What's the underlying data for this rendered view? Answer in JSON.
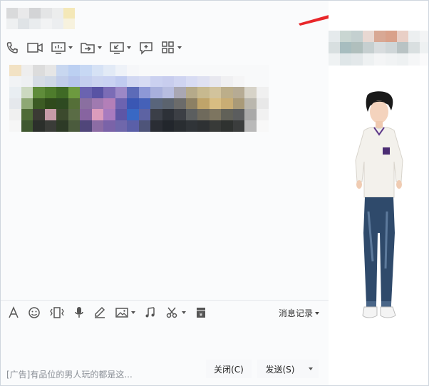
{
  "window": {
    "minimize_icon": "minimize-icon",
    "maximize_icon": "maximize-icon",
    "close_icon": "close-icon",
    "menu_icon": "dropdown-triangle-icon"
  },
  "toolbar": {
    "items": [
      {
        "icon": "phone-icon",
        "has_dropdown": false
      },
      {
        "icon": "video-camera-icon",
        "has_dropdown": false
      },
      {
        "icon": "screen-share-icon",
        "has_dropdown": true
      },
      {
        "icon": "send-file-icon",
        "has_dropdown": true
      },
      {
        "icon": "remote-desktop-icon",
        "has_dropdown": true
      },
      {
        "icon": "add-chat-icon",
        "has_dropdown": false
      },
      {
        "icon": "apps-grid-icon",
        "has_dropdown": true
      }
    ]
  },
  "input_toolbar": {
    "items": [
      {
        "icon": "font-icon"
      },
      {
        "icon": "emoji-icon"
      },
      {
        "icon": "shake-icon"
      },
      {
        "icon": "microphone-icon"
      },
      {
        "icon": "pen-icon"
      },
      {
        "icon": "image-icon"
      },
      {
        "icon": "music-icon"
      },
      {
        "icon": "scissors-icon"
      },
      {
        "icon": "red-packet-icon"
      }
    ],
    "history_label": "消息记录"
  },
  "footer": {
    "ad_text": "[广告]有品位的男人玩的都是这...",
    "close_button": "关闭(C)",
    "send_button": "发送(S)"
  },
  "colors": {
    "annotation_arrow": "#e8262a",
    "accent": "#5f3a8a"
  }
}
